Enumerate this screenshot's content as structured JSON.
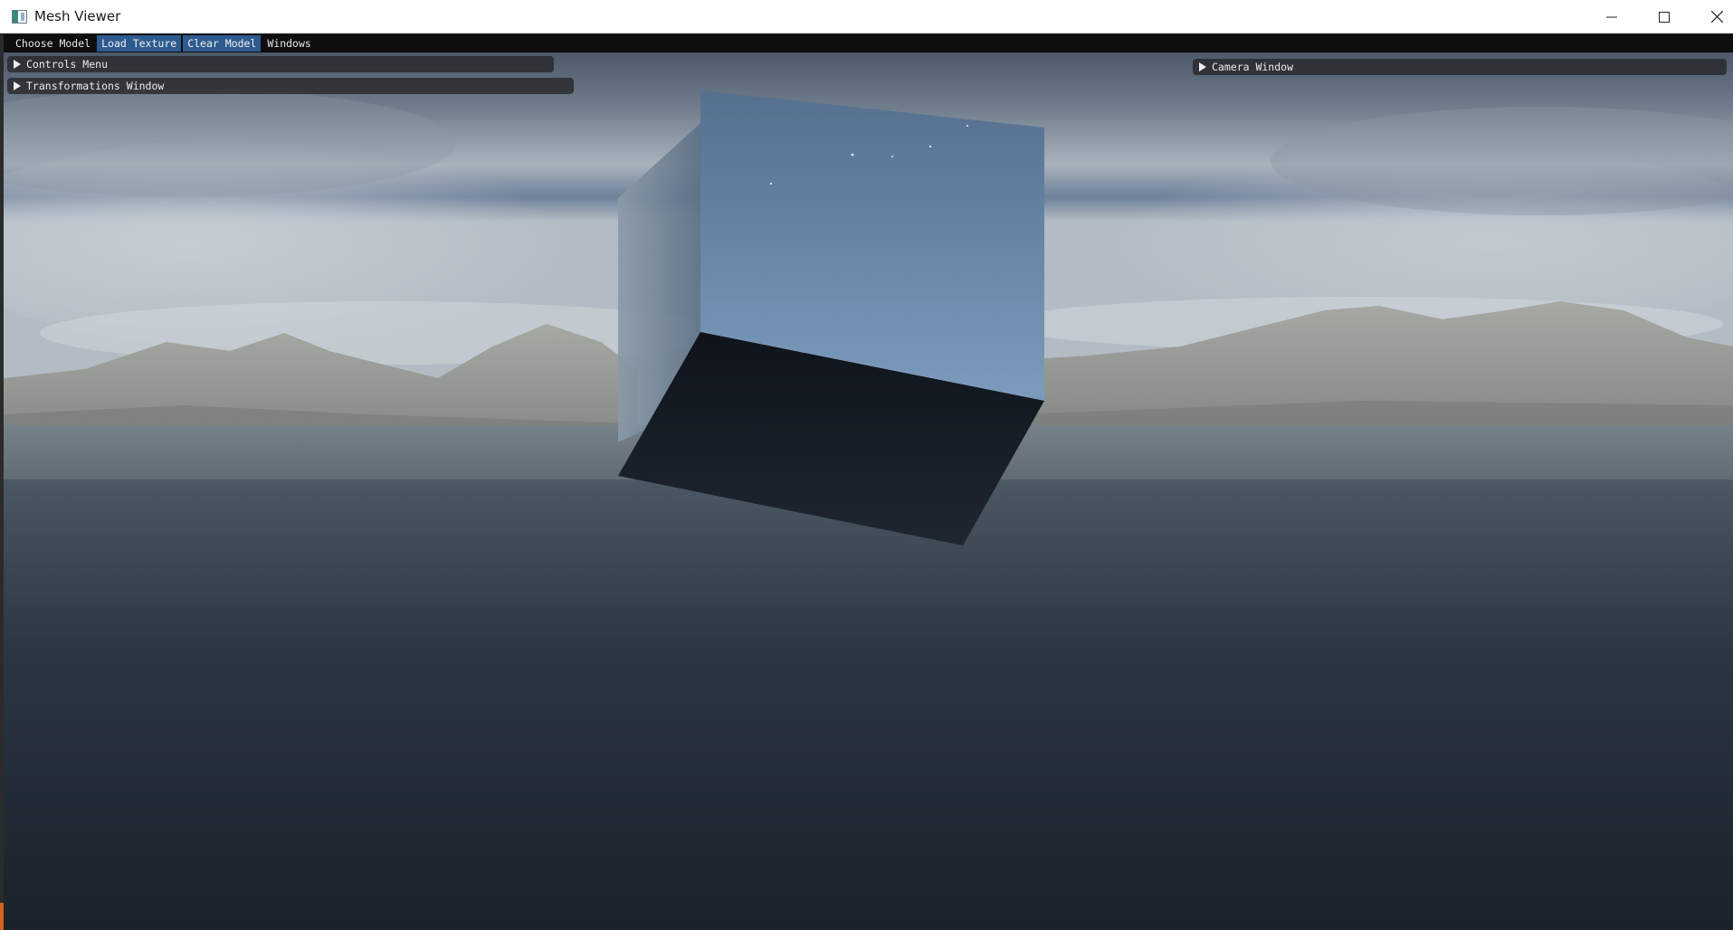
{
  "window": {
    "title": "Mesh Viewer",
    "icons": {
      "app": "app-window-icon",
      "minimize": "minimize-icon",
      "maximize": "maximize-icon",
      "close": "close-icon"
    }
  },
  "menubar": {
    "items": [
      {
        "label": "Choose Model",
        "active": false
      },
      {
        "label": "Load Texture",
        "active": true
      },
      {
        "label": "Clear Model",
        "active": true
      },
      {
        "label": "Windows",
        "active": false
      }
    ]
  },
  "panels": {
    "controls": {
      "label": "Controls Menu",
      "collapsed": true
    },
    "transformations": {
      "label": "Transformations Window",
      "collapsed": true
    },
    "camera": {
      "label": "Camera Window",
      "collapsed": true
    }
  },
  "scene": {
    "content": "reflective cube over skybox of ocean and mountains",
    "colors": {
      "sky_top": "#4a5a6c",
      "cloud": "#b9c3cc",
      "mountain": "#8c8f8a",
      "water": "#2b3440",
      "cube_front": "#6f8fb3",
      "cube_bottom": "#141a22",
      "accent": "#2e5b8f"
    }
  }
}
